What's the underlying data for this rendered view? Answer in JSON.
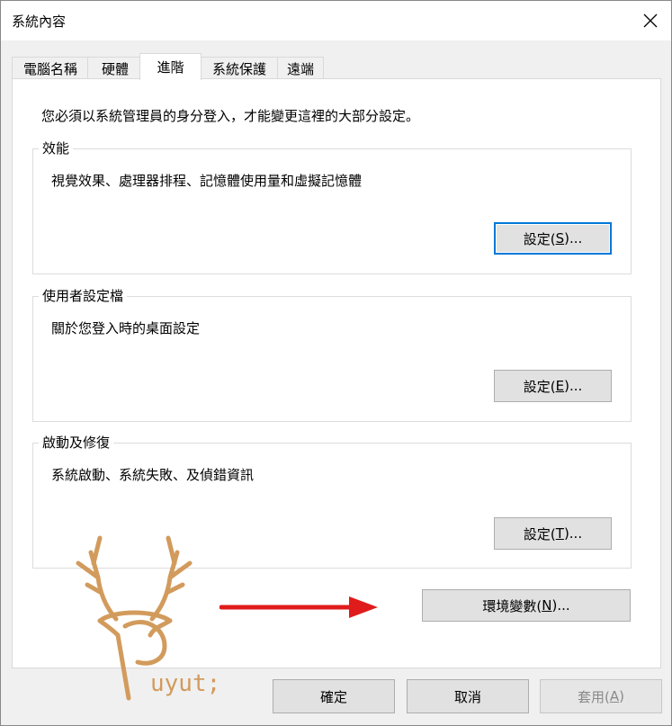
{
  "window": {
    "title": "系統內容"
  },
  "tabs": [
    "電腦名稱",
    "硬體",
    "進階",
    "系統保護",
    "遠端"
  ],
  "active_tab": "進階",
  "intro": "您必須以系統管理員的身分登入，才能變更這裡的大部分設定。",
  "performance": {
    "label": "效能",
    "desc": "視覺效果、處理器排程、記憶體使用量和虛擬記憶體",
    "btn_text": "設定(",
    "btn_key": "S",
    "btn_tail": ")..."
  },
  "profiles": {
    "label": "使用者設定檔",
    "desc": "關於您登入時的桌面設定",
    "btn_text": "設定(",
    "btn_key": "E",
    "btn_tail": ")..."
  },
  "startup": {
    "label": "啟動及修復",
    "desc": "系統啟動、系統失敗、及偵錯資訊",
    "btn_text": "設定(",
    "btn_key": "T",
    "btn_tail": ")..."
  },
  "env": {
    "btn_text": "環境變數(",
    "btn_key": "N",
    "btn_tail": ")..."
  },
  "footer": {
    "ok": "確定",
    "cancel": "取消",
    "apply_text": "套用(",
    "apply_key": "A",
    "apply_tail": ")"
  },
  "watermark": {
    "text": "uyut;"
  },
  "colors": {
    "accent": "#0078d7",
    "arrow": "#e01b1b",
    "watermark": "#d29b5c"
  }
}
